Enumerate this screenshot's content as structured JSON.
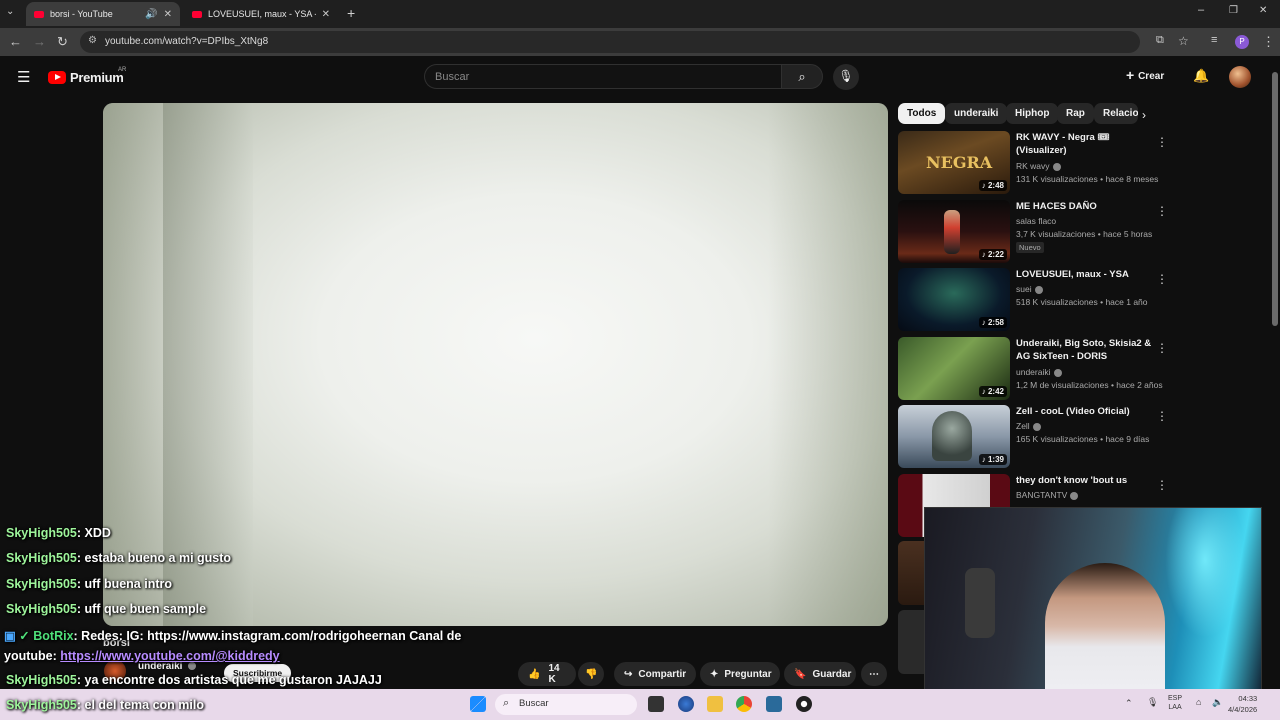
{
  "browser": {
    "tabs": [
      {
        "title": "borsi - YouTube",
        "active": true
      },
      {
        "title": "LOVEUSUEI, maux - YSA - YouTu",
        "active": false
      }
    ],
    "url": "youtube.com/watch?v=DPIbs_XtNg8",
    "profile_initial": "P"
  },
  "header": {
    "logo": "Premium",
    "country": "AR",
    "search_placeholder": "Buscar",
    "create_label": "Crear"
  },
  "video": {
    "title": "borsi",
    "channel": "underaiki",
    "subscribe_label": "Suscribirme",
    "likes": "14 K",
    "share_label": "Compartir",
    "ask_label": "Preguntar",
    "save_label": "Guardar"
  },
  "chips": [
    "Todos",
    "underaiki",
    "Hiphop",
    "Rap",
    "Relacio"
  ],
  "recommendations": [
    {
      "title": "RK WAVY - Negra 🎟 (Visualizer)",
      "channel": "RK wavy",
      "meta": "131 K visualizaciones • hace 8 meses",
      "duration": "2:48",
      "badge": ""
    },
    {
      "title": "ME HACES DAÑO",
      "channel": "salas flaco",
      "meta": "3,7 K visualizaciones • hace 5 horas",
      "duration": "2:22",
      "badge": "Nuevo"
    },
    {
      "title": "LOVEUSUEI, maux - YSA",
      "channel": "suei",
      "meta": "518 K visualizaciones • hace 1 año",
      "duration": "2:58",
      "badge": ""
    },
    {
      "title": "Underaiki, Big Soto, Skisia2 & AG SixTeen - DORIS",
      "channel": "underaiki",
      "meta": "1,2 M de visualizaciones • hace 2 años",
      "duration": "2:42",
      "badge": ""
    },
    {
      "title": "Zell - cooL (Video Oficial)",
      "channel": "Zell",
      "meta": "165 K visualizaciones • hace 9 días",
      "duration": "1:39",
      "badge": ""
    },
    {
      "title": "they don't know 'bout us",
      "channel": "BANGTANTV",
      "meta": "",
      "duration": "",
      "badge": ""
    }
  ],
  "chat": [
    {
      "user": "SkyHigh505",
      "msg": ": XDD"
    },
    {
      "user": "SkyHigh505",
      "msg": ": estaba bueno a mi gusto"
    },
    {
      "user": "SkyHigh505",
      "msg": ": uff buena intro"
    },
    {
      "user": "SkyHigh505",
      "msg": ": uff que buen sample"
    }
  ],
  "bot": {
    "user": "BotRix",
    "msg_line1": ": Redes: IG: https://www.instagram.com/rodrigoheernan Canal de",
    "msg_line2_prefix": "youtube: ",
    "link": "https://www.youtube.com/@kiddredy"
  },
  "chat_after": [
    {
      "user": "SkyHigh505",
      "msg": ": ya encontre dos artistas que me gustaron JAJAJJ"
    },
    {
      "user": "SkyHigh505",
      "msg": ": el del tema con milo"
    }
  ],
  "taskbar": {
    "search_placeholder": "Buscar",
    "lang_top": "ESP",
    "lang_bottom": "LAA",
    "time": "04:33",
    "date": "4/4/2026"
  }
}
